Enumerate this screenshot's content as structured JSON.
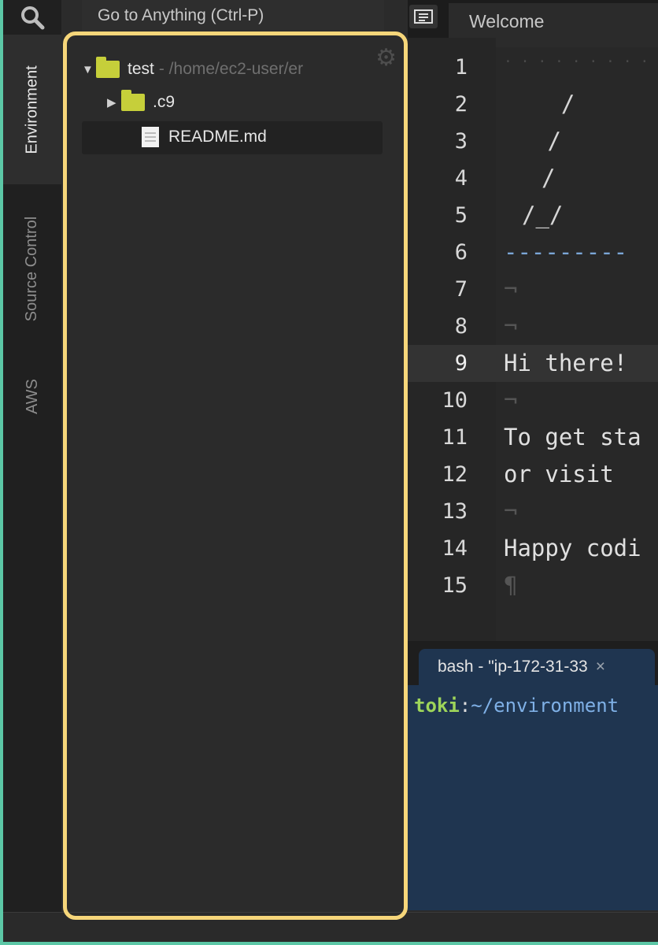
{
  "rail": {
    "tabs": [
      {
        "label": "Environment",
        "active": true
      },
      {
        "label": "Source Control",
        "active": false
      },
      {
        "label": "AWS",
        "active": false
      }
    ]
  },
  "goto": {
    "label": "Go to Anything (Ctrl-P)"
  },
  "tree": {
    "root": {
      "name": "test",
      "path": "- /home/ec2-user/er"
    },
    "items": [
      {
        "name": ".c9",
        "type": "folder"
      },
      {
        "name": "README.md",
        "type": "file"
      }
    ]
  },
  "editor": {
    "tab_label": "Welcome",
    "line_numbers": [
      "1",
      "2",
      "3",
      "4",
      "5",
      "6",
      "7",
      "8",
      "9",
      "10",
      "11",
      "12",
      "13",
      "14",
      "15"
    ],
    "lines": [
      "",
      "  /",
      " / ",
      "/ ",
      "/_/",
      "---------",
      "¬",
      "¬",
      "Hi there!",
      "¬",
      "To get sta",
      "or visit ",
      "¬",
      "Happy codi",
      "¶"
    ],
    "active_line": 9
  },
  "terminal": {
    "tab_label": "bash - \"ip-172-31-33",
    "close": "×",
    "prompt_user": "toki",
    "prompt_sep": ":",
    "prompt_dir": "~/environment"
  },
  "colors": {
    "highlight": "#f6d67a",
    "frame": "#5cc7a6",
    "folder": "#c6cf3a"
  }
}
